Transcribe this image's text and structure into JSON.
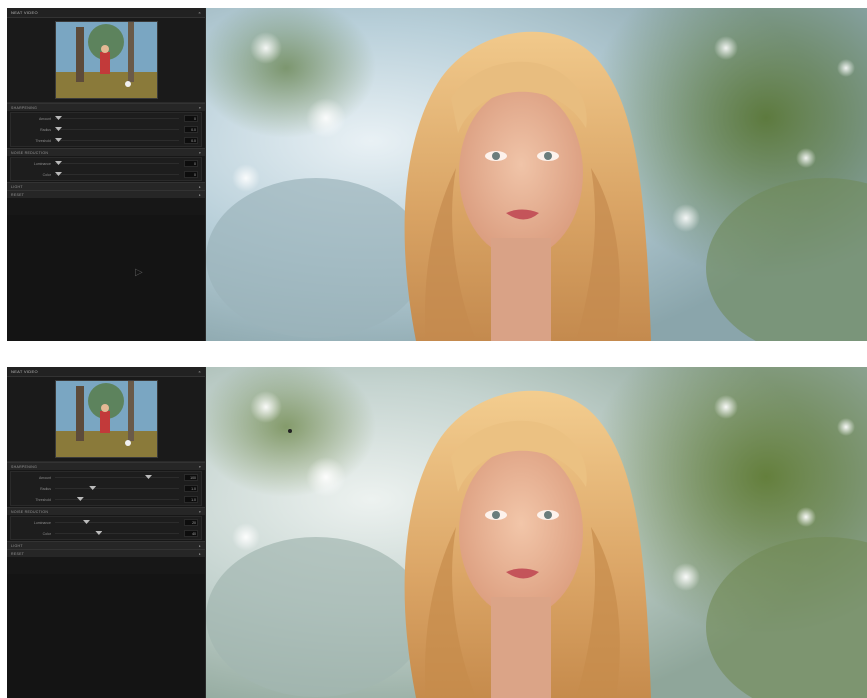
{
  "panel": {
    "title": "NEAT VIDEO",
    "close": "×",
    "sections": {
      "sharpening": "SHARPENING",
      "noise_reduction": "NOISE REDUCTION",
      "light": "LIGHT",
      "reset": "RESET"
    }
  },
  "top_panel": {
    "sliders": [
      {
        "label": "Amount",
        "value": "0"
      },
      {
        "label": "Radius",
        "value": "0.0"
      },
      {
        "label": "Threshold",
        "value": "0.0"
      }
    ],
    "nr_sliders": [
      {
        "label": "Luminance",
        "value": "0"
      },
      {
        "label": "Color",
        "value": "0"
      }
    ]
  },
  "bottom_panel": {
    "sliders": [
      {
        "label": "Amount",
        "value": "100",
        "level": 0.75
      },
      {
        "label": "Radius",
        "value": "1.0",
        "level": 0.3
      },
      {
        "label": "Threshold",
        "value": "1.0",
        "level": 0.2
      }
    ],
    "nr_sliders": [
      {
        "label": "Luminance",
        "value": "20",
        "level": 0.25
      },
      {
        "label": "Color",
        "value": "40",
        "level": 0.35
      }
    ]
  },
  "colors": {
    "panel_bg": "#171717",
    "sky": "#cfe0ec",
    "foliage": "#6f8a4f",
    "hair": "#d9a868",
    "skin": "#e6b095",
    "lips": "#c4545a"
  }
}
